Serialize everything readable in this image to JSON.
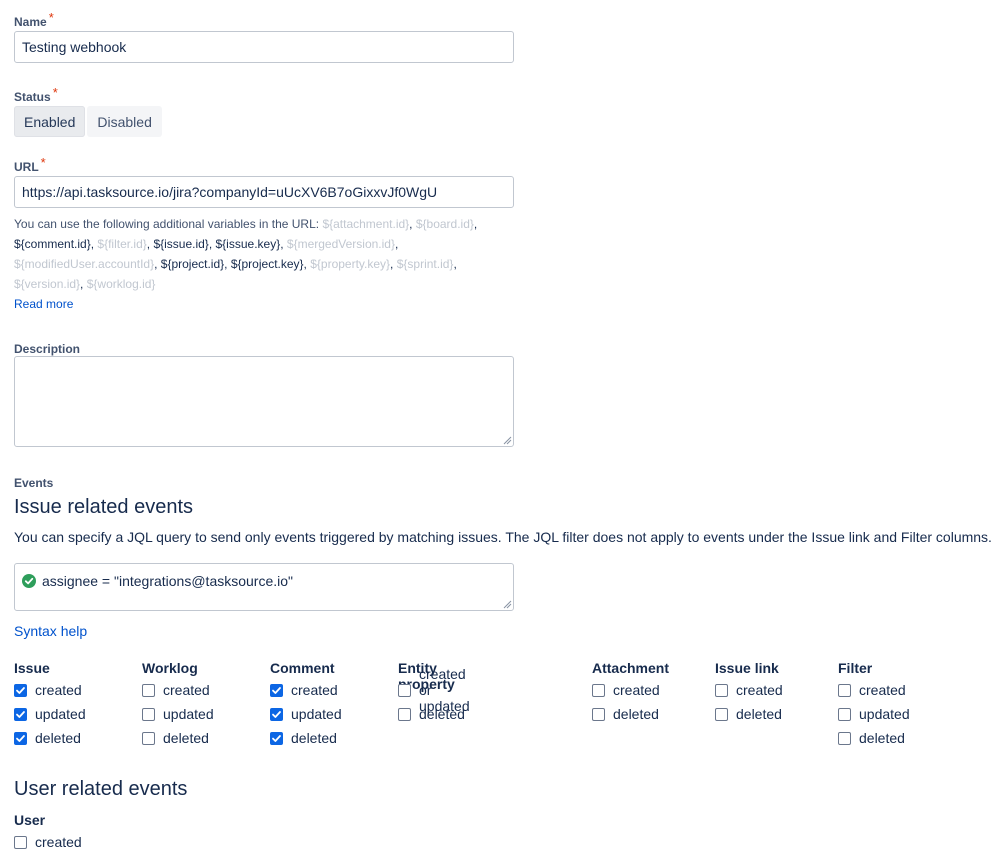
{
  "name": {
    "label": "Name",
    "required_mark": "*",
    "value": "Testing webhook"
  },
  "status": {
    "label": "Status",
    "required_mark": "*",
    "options": [
      "Enabled",
      "Disabled"
    ],
    "selected": "Enabled"
  },
  "url": {
    "label": "URL",
    "required_mark": "*",
    "value": "https://api.tasksource.io/jira?companyId=uUcXV6B7oGixxvJf0WgU",
    "help_intro": "You can use the following additional variables in the URL:",
    "variables": [
      {
        "text": "${attachment.id}",
        "available": false
      },
      {
        "text": "${board.id}",
        "available": false
      },
      {
        "text": "${comment.id}",
        "available": true
      },
      {
        "text": "${filter.id}",
        "available": false
      },
      {
        "text": "${issue.id}",
        "available": true
      },
      {
        "text": "${issue.key}",
        "available": true
      },
      {
        "text": "${mergedVersion.id}",
        "available": false
      },
      {
        "text": "${modifiedUser.accountId}",
        "available": false
      },
      {
        "text": "${project.id}",
        "available": true
      },
      {
        "text": "${project.key}",
        "available": true
      },
      {
        "text": "${property.key}",
        "available": false
      },
      {
        "text": "${sprint.id}",
        "available": false
      },
      {
        "text": "${version.id}",
        "available": false
      },
      {
        "text": "${worklog.id}",
        "available": false
      }
    ],
    "read_more": "Read more"
  },
  "description": {
    "label": "Description",
    "value": ""
  },
  "events": {
    "label": "Events",
    "issue_heading": "Issue related events",
    "jql_help": "You can specify a JQL query to send only events triggered by matching issues. The JQL filter does not apply to events under the Issue link and Filter columns.",
    "jql_value": "assignee = \"integrations@tasksource.io\"",
    "syntax_help": "Syntax help",
    "columns": [
      {
        "title": "Issue",
        "items": [
          {
            "label": "created",
            "checked": true
          },
          {
            "label": "updated",
            "checked": true
          },
          {
            "label": "deleted",
            "checked": true
          }
        ]
      },
      {
        "title": "Worklog",
        "items": [
          {
            "label": "created",
            "checked": false
          },
          {
            "label": "updated",
            "checked": false
          },
          {
            "label": "deleted",
            "checked": false
          }
        ]
      },
      {
        "title": "Comment",
        "items": [
          {
            "label": "created",
            "checked": true
          },
          {
            "label": "updated",
            "checked": true
          },
          {
            "label": "deleted",
            "checked": true
          }
        ]
      },
      {
        "title": "Entity property",
        "items": [
          {
            "label": "created or updated",
            "checked": false
          },
          {
            "label": "deleted",
            "checked": false
          }
        ]
      },
      {
        "title": "Attachment",
        "items": [
          {
            "label": "created",
            "checked": false
          },
          {
            "label": "deleted",
            "checked": false
          }
        ]
      },
      {
        "title": "Issue link",
        "items": [
          {
            "label": "created",
            "checked": false
          },
          {
            "label": "deleted",
            "checked": false
          }
        ]
      },
      {
        "title": "Filter",
        "items": [
          {
            "label": "created",
            "checked": false
          },
          {
            "label": "updated",
            "checked": false
          },
          {
            "label": "deleted",
            "checked": false
          }
        ]
      }
    ],
    "user_heading": "User related events",
    "user_column": {
      "title": "User",
      "items": [
        {
          "label": "created",
          "checked": false
        }
      ]
    }
  },
  "colors": {
    "accent": "#0052cc",
    "checkbox": "#0c66e4",
    "valid": "#36b37e",
    "required": "#de350b"
  }
}
